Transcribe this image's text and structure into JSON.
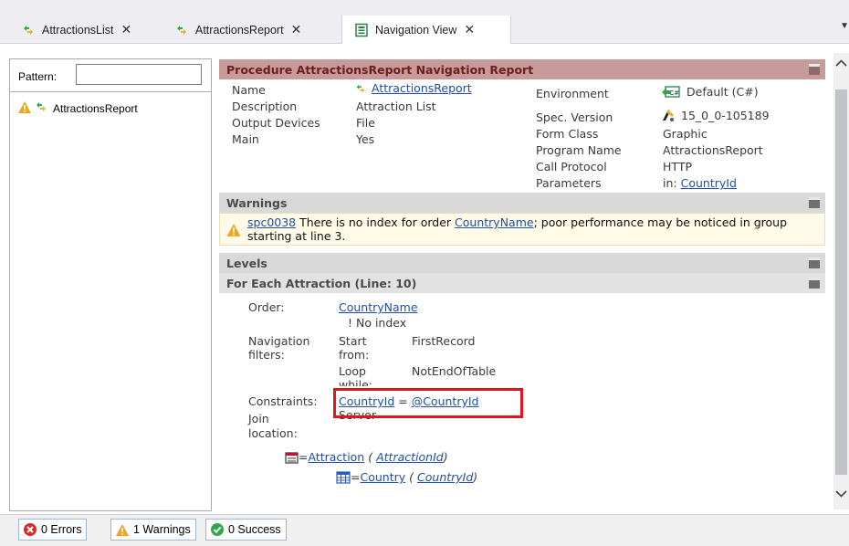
{
  "tabs": [
    {
      "label": "AttractionsList",
      "close": "✕",
      "active": false
    },
    {
      "label": "AttractionsReport",
      "close": "✕",
      "active": false
    },
    {
      "label": "Navigation View",
      "close": "✕",
      "active": true
    }
  ],
  "tab_overflow": "▼",
  "left_panel": {
    "pattern_label": "Pattern:",
    "pattern_value": "",
    "tree_item": "AttractionsReport"
  },
  "report": {
    "title": "Procedure AttractionsReport Navigation Report",
    "props_left": [
      {
        "key": "Name",
        "value": "AttractionsReport",
        "link": true
      },
      {
        "key": "Description",
        "value": "Attraction List"
      },
      {
        "key": "Output Devices",
        "value": "File"
      },
      {
        "key": "Main",
        "value": "Yes"
      }
    ],
    "props_right": [
      {
        "key": "Environment",
        "value": "Default (C#)"
      },
      {
        "key": "Spec. Version",
        "value": "15_0_0-105189"
      },
      {
        "key": "Form Class",
        "value": "Graphic"
      },
      {
        "key": "Program Name",
        "value": "AttractionsReport"
      },
      {
        "key": "Call Protocol",
        "value": "HTTP"
      },
      {
        "key": "Parameters",
        "value_prefix": "in: ",
        "value_link": "CountryId"
      }
    ],
    "warnings_title": "Warnings",
    "warning": {
      "code": "spc0038",
      "text_before": " There is no index for order ",
      "link": "CountryName",
      "text_after": "; poor performance may be noticed in group starting at line 3."
    },
    "levels_title": "Levels",
    "foreach_title": "For Each Attraction (Line: 10)",
    "order_label": "Order:",
    "order_value": "CountryName",
    "order_note": "! No index",
    "nav_filters_label_1": "Navigation",
    "nav_filters_label_2": "filters:",
    "start_label_1": "Start",
    "start_label_2": "from:",
    "start_value": "FirstRecord",
    "loop_label_1": "Loop",
    "loop_label_2": "while:",
    "loop_value": "NotEndOfTable",
    "constraints_label": "Constraints:",
    "constraint_left": "CountryId",
    "constraint_op": " = ",
    "constraint_right": "@CountryId",
    "join_label_1": "Join",
    "join_label_2": "location:",
    "join_value": "Server",
    "table_1_name": "Attraction",
    "table_1_key": "AttractionId",
    "table_2_name": "Country",
    "table_2_key": "CountryId"
  },
  "status": {
    "errors": "0 Errors",
    "warnings": "1 Warnings",
    "success": "0 Success"
  },
  "colors": {
    "header_accent": "#c99a9a",
    "highlight": "#e0161e",
    "link": "#1f4fa8"
  }
}
